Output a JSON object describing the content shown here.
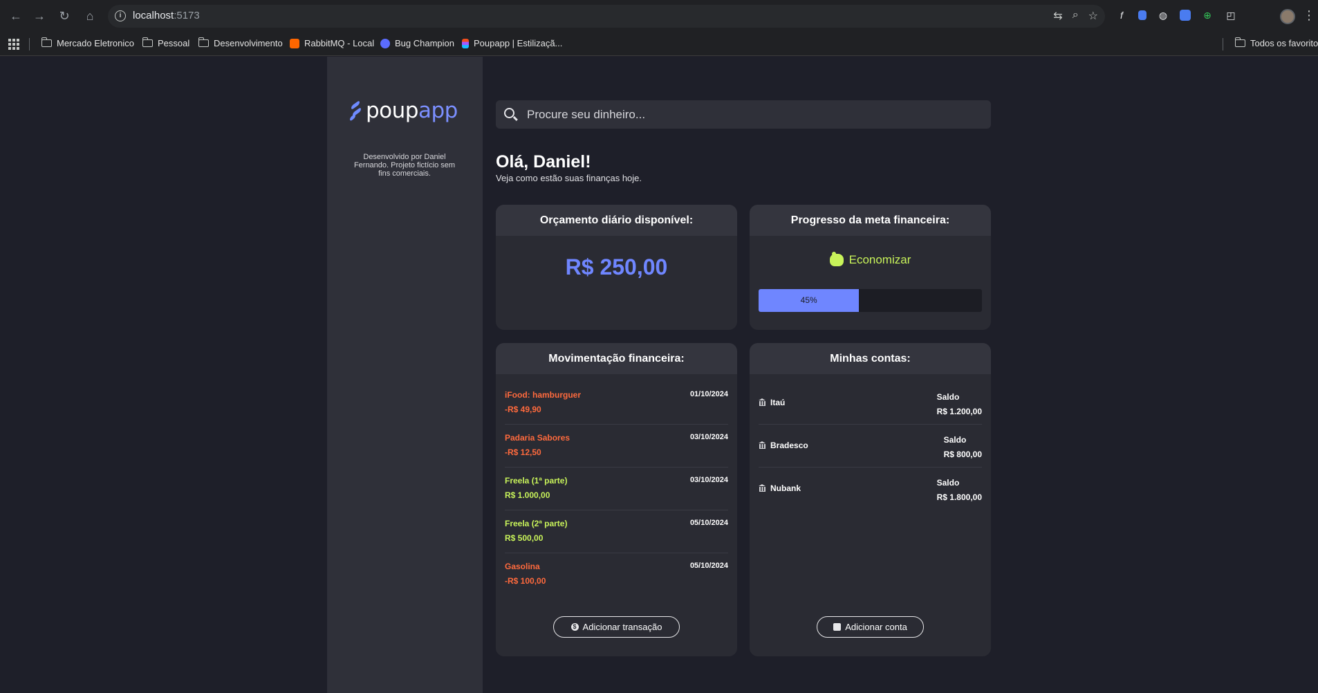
{
  "browser": {
    "url_host": "localhost",
    "url_port": ":5173",
    "bookmarks": [
      {
        "label": "Mercado Eletronico",
        "type": "folder"
      },
      {
        "label": "Pessoal",
        "type": "folder"
      },
      {
        "label": "Desenvolvimento",
        "type": "folder"
      },
      {
        "label": "RabbitMQ - Local",
        "type": "site",
        "color": "#ff6600"
      },
      {
        "label": "Bug Champion",
        "type": "site",
        "color": "#5b6cff"
      },
      {
        "label": "Poupapp | Estilizaçã...",
        "type": "site",
        "color": "#f24e1e"
      },
      {
        "label": "Todos os favoritos",
        "type": "folder"
      }
    ]
  },
  "sidebar": {
    "logo_poup": "poup",
    "logo_app": "app",
    "dev_note": "Desenvolvido por Daniel Fernando. Projeto fictício sem fins comerciais."
  },
  "search": {
    "placeholder": "Procure seu dinheiro..."
  },
  "greeting": {
    "title": "Olá, Daniel!",
    "subtitle": "Veja como estão suas finanças hoje."
  },
  "budget": {
    "title": "Orçamento diário disponível:",
    "value": "R$ 250,00"
  },
  "goal": {
    "title": "Progresso da meta financeira:",
    "label": "Economizar",
    "progress_percent": 45,
    "progress_text": "45%"
  },
  "movements": {
    "title": "Movimentação financeira:",
    "items": [
      {
        "name": "iFood: hamburguer",
        "amount": "-R$ 49,90",
        "date": "01/10/2024",
        "kind": "neg"
      },
      {
        "name": "Padaria Sabores",
        "amount": "-R$ 12,50",
        "date": "03/10/2024",
        "kind": "neg"
      },
      {
        "name": "Freela (1ª parte)",
        "amount": "R$ 1.000,00",
        "date": "03/10/2024",
        "kind": "pos"
      },
      {
        "name": "Freela (2ª parte)",
        "amount": "R$ 500,00",
        "date": "05/10/2024",
        "kind": "pos"
      },
      {
        "name": "Gasolina",
        "amount": "-R$ 100,00",
        "date": "05/10/2024",
        "kind": "neg"
      }
    ],
    "add_button": "Adicionar transação"
  },
  "accounts": {
    "title": "Minhas contas:",
    "items": [
      {
        "name": "Itaú",
        "balance_label": "Saldo",
        "balance": "R$ 1.200,00"
      },
      {
        "name": "Bradesco",
        "balance_label": "Saldo",
        "balance": "R$ 800,00"
      },
      {
        "name": "Nubank",
        "balance_label": "Saldo",
        "balance": "R$ 1.800,00"
      }
    ],
    "add_button": "Adicionar conta"
  },
  "colors": {
    "accent": "#6f86ff",
    "positive": "#c8f35a",
    "negative": "#ff6a3d",
    "background": "#1e1f29",
    "card": "#2a2b33"
  }
}
